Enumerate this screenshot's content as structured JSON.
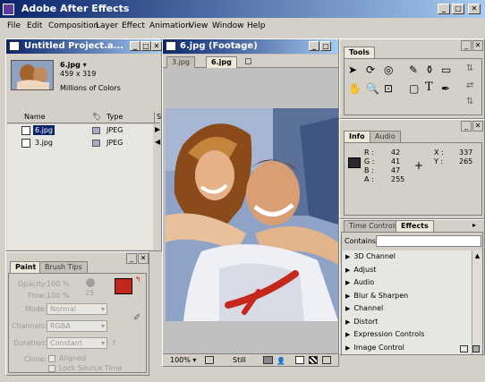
{
  "app": {
    "title": "Adobe After Effects"
  },
  "colors": {
    "titlebar": "#0a246a",
    "titlebar_end": "#a6caf0",
    "chrome": "#d4d0c8",
    "paint_color": "#c4281c",
    "info_swatch": "#2a292f"
  },
  "menu": [
    "File",
    "Edit",
    "Composition",
    "Layer",
    "Effect",
    "Animation",
    "View",
    "Window",
    "Help"
  ],
  "project": {
    "title": "Untitled Project.a...",
    "thumb_name": "6.jpg ▾",
    "thumb_dims": "459 x 319",
    "thumb_colors": "Millions of Colors",
    "col_name": "Name",
    "col_type": "Type",
    "col_size": "Siz",
    "items": [
      {
        "name": "6.jpg",
        "type": "JPEG",
        "selected": true
      },
      {
        "name": "3.jpg",
        "type": "JPEG",
        "selected": false
      }
    ]
  },
  "footage": {
    "title": "6.jpg (Footage)",
    "tabs": [
      "3.jpg",
      "6.jpg"
    ],
    "zoom": "100% ▾",
    "mode": "Still"
  },
  "tools": {
    "title": "Tools"
  },
  "info": {
    "tabs": [
      "Info",
      "Audio"
    ],
    "r_label": "R :",
    "r_value": "42",
    "g_label": "G :",
    "g_value": "41",
    "b_label": "B :",
    "b_value": "47",
    "a_label": "A :",
    "a_value": "255",
    "x_label": "X :",
    "x_value": "337",
    "y_label": "Y :",
    "y_value": "265"
  },
  "effects": {
    "tabs": [
      "Time Controls",
      "Effects"
    ],
    "contains_label": "Contains:",
    "contains_value": "",
    "items": [
      "3D Channel",
      "Adjust",
      "Audio",
      "Blur & Sharpen",
      "Channel",
      "Distort",
      "Expression Controls",
      "Image Control"
    ]
  },
  "paint": {
    "tabs": [
      "Paint",
      "Brush Tips"
    ],
    "opacity_label": "Opacity:",
    "opacity_value": "100 %",
    "flow_label": "Flow:",
    "flow_value": "100 %",
    "brush_size": "25",
    "mode_label": "Mode:",
    "mode_value": "Normal",
    "channels_label": "Channels:",
    "channels_value": "RGBA",
    "duration_label": "Duration:",
    "duration_value": "Constant",
    "duration_f": "f",
    "clone_label": "Clone:",
    "aligned_label": "Aligned",
    "lock_label": "Lock Source Time"
  }
}
